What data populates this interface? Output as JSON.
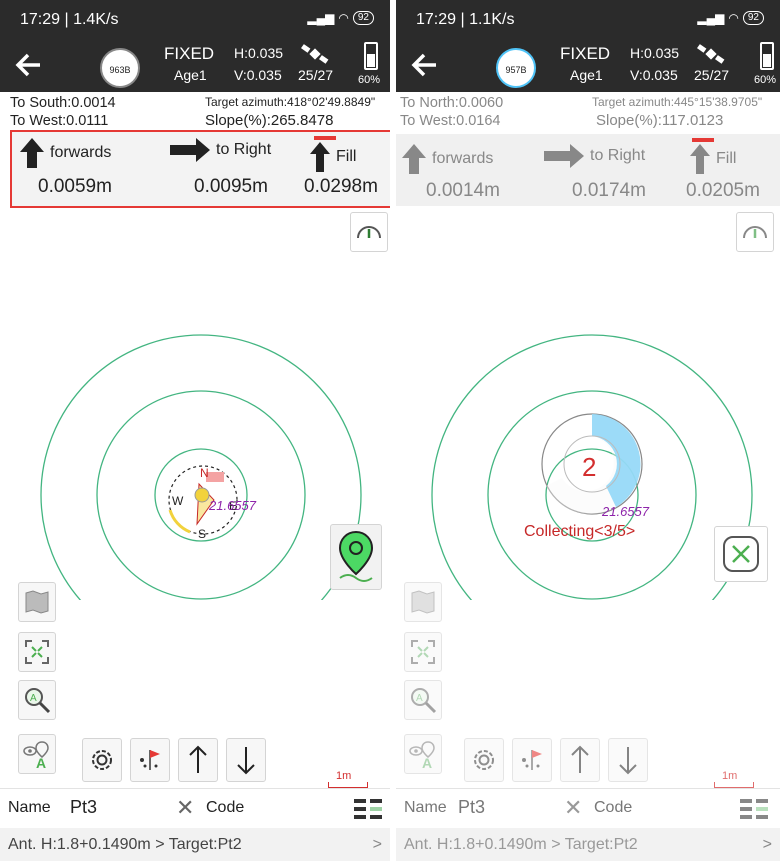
{
  "left": {
    "status": {
      "time": "17:29 | 1.4K/s",
      "signal": "⁺ⱼᵗⱼᵗ",
      "battery": "92"
    },
    "header": {
      "sat_disc": "963B",
      "mode": "FIXED",
      "age": "Age1",
      "h": "H:0.035",
      "v": "V:0.035",
      "sat_count": "25/27",
      "battery_pct": "60%"
    },
    "info": {
      "line1": "To South:0.0014",
      "line2": "To West:0.0111",
      "azimuth": "Target azimuth:418°02'49.8849\"",
      "slope": "Slope(%):265.8478"
    },
    "nav": {
      "forwards_label": "forwards",
      "forwards_value": "0.0059m",
      "right_label": "to Right",
      "right_value": "0.0095m",
      "fill_label": "Fill",
      "fill_value": "0.0298m"
    },
    "compass": {
      "n": "N",
      "s": "S",
      "e": "E",
      "w": "W",
      "point_label": "21.6557"
    },
    "scale": "1m",
    "name": {
      "label": "Name",
      "value": "Pt3",
      "code_label": "Code"
    },
    "ant": {
      "text": "Ant. H:1.8+0.1490m > Target:Pt2",
      "chevron": ">"
    }
  },
  "right": {
    "status": {
      "time": "17:29 | 1.1K/s",
      "battery": "92"
    },
    "header": {
      "sat_disc": "957B",
      "mode": "FIXED",
      "age": "Age1",
      "h": "H:0.035",
      "v": "V:0.035",
      "sat_count": "25/27",
      "battery_pct": "60%"
    },
    "info": {
      "line1": "To North:0.0060",
      "line2": "To West:0.0164",
      "azimuth": "Target azimuth:445°15'38.9705\"",
      "slope": "Slope(%):117.0123"
    },
    "nav": {
      "forwards_label": "forwards",
      "forwards_value": "0.0014m",
      "right_label": "to Right",
      "right_value": "0.0174m",
      "fill_label": "Fill",
      "fill_value": "0.0205m"
    },
    "collecting": {
      "count": "2",
      "text": "Collecting<3/5>",
      "point_label": "21.6557"
    },
    "scale": "1m",
    "name": {
      "label": "Name",
      "value": "Pt3",
      "code_label": "Code"
    },
    "ant": {
      "text": "Ant. H:1.8+0.1490m > Target:Pt2",
      "chevron": ">"
    }
  },
  "colors": {
    "header_bg": "#2b2b2b",
    "ring": "#43b581",
    "highlight_box": "#e53935",
    "collect_blue": "#4fc3f7",
    "collect_text": "#e53935"
  },
  "icons": [
    "back-arrow-icon",
    "satellite-icon",
    "battery-icon",
    "gauge-icon",
    "map-pin-icon",
    "folded-map-icon",
    "fit-screen-icon",
    "zoom-icon",
    "eye-point-icon",
    "settings-gear-icon",
    "flag-points-icon",
    "up-arrow-icon",
    "down-arrow-icon",
    "menu-list-icon",
    "cancel-x-icon"
  ]
}
